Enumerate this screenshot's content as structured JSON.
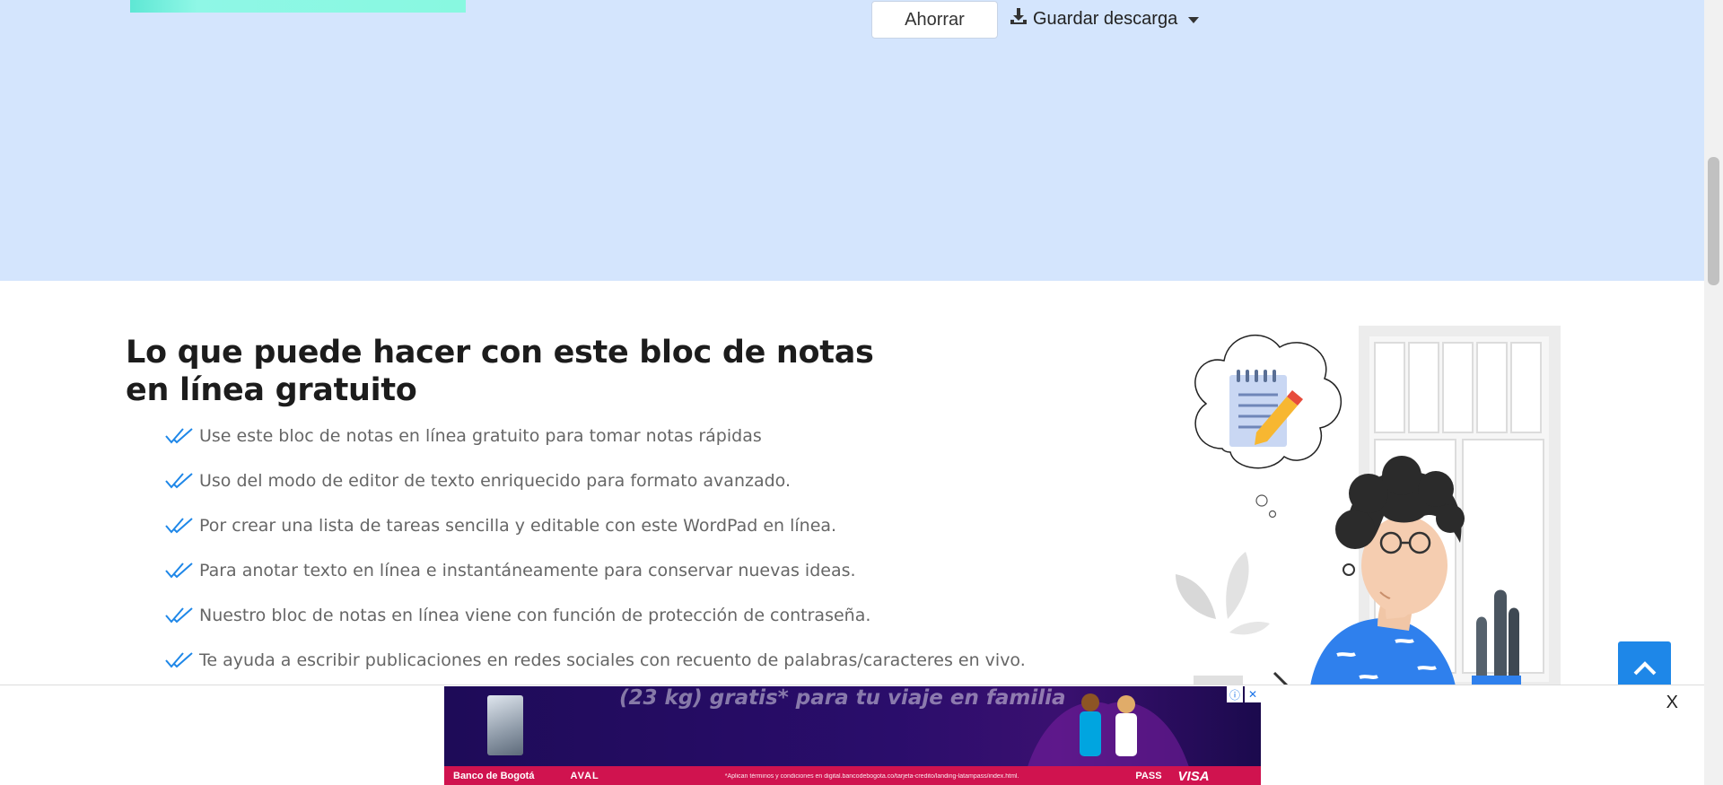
{
  "toolbar": {
    "save_label": "Ahorrar",
    "download_label": "Guardar descarga"
  },
  "features": {
    "title": "Lo que puede hacer con este bloc de notas en línea gratuito",
    "items": [
      "Use este bloc de notas en línea gratuito para tomar notas rápidas",
      "Uso del modo de editor de texto enriquecido para formato avanzado.",
      "Por crear una lista de tareas sencilla y editable con este WordPad en línea.",
      "Para anotar texto en línea e instantáneamente para conservar nuevas ideas.",
      "Nuestro bloc de notas en línea viene con función de protección de contraseña.",
      "Te ayuda a escribir publicaciones en redes sociales con recuento de palabras/caracteres en vivo."
    ]
  },
  "ad": {
    "headline": "(23 kg) gratis* para tu viaje en familia",
    "bank": "Banco de Bogotá",
    "network": "AVAL",
    "terms": "*Aplican términos y condiciones en digital.bancodebogota.co/tarjeta-credito/landing-latampass/index.html.",
    "latam": "PASS",
    "card_brand": "VISA",
    "close_label": "X"
  },
  "colors": {
    "hero_bg": "#d4e5fd",
    "accent": "#1e87e8",
    "check": "#1e87e8",
    "ad_footer": "#d0134f"
  },
  "icons": [
    "download-icon",
    "chevron-down-icon",
    "double-check-icon",
    "chevron-up-icon",
    "info-icon",
    "close-icon"
  ]
}
